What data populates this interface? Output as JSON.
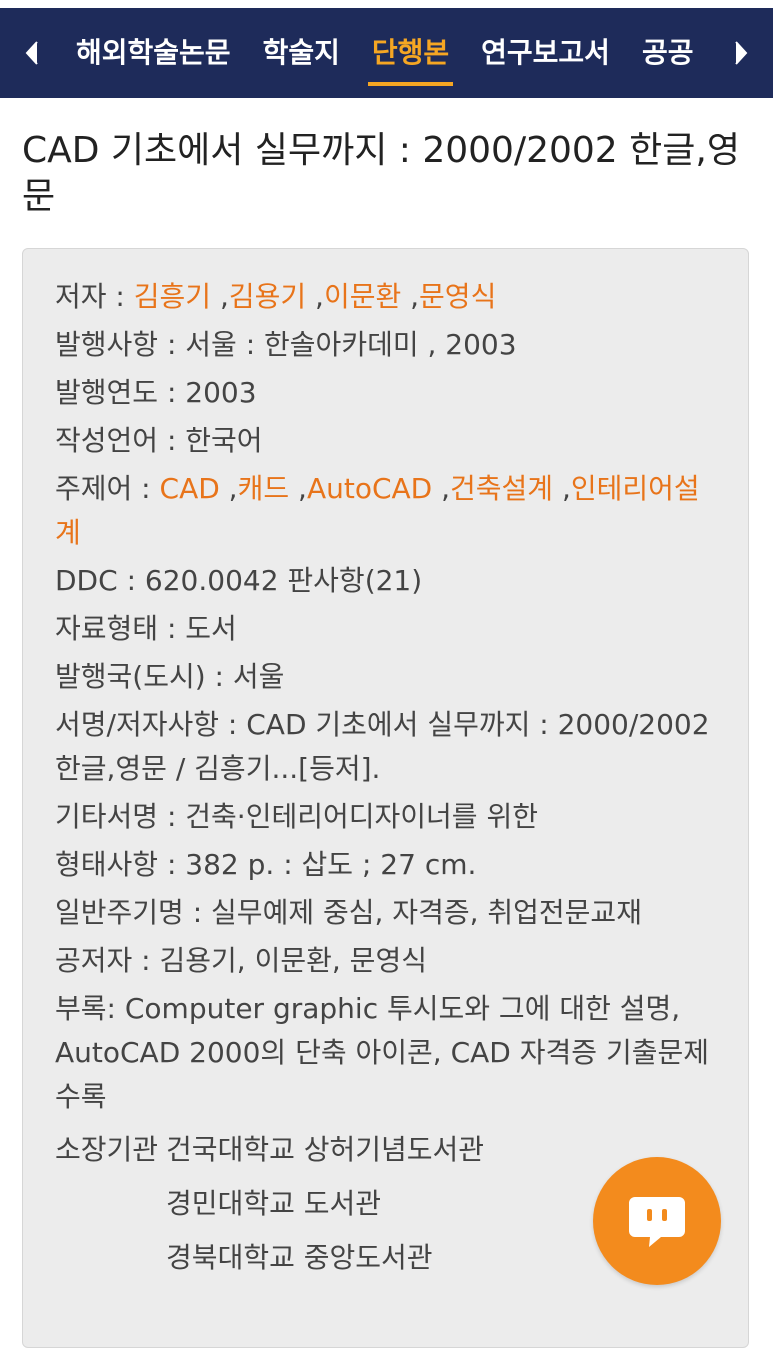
{
  "tabs": {
    "items": [
      {
        "label": "해외학술논문"
      },
      {
        "label": "학술지"
      },
      {
        "label": "단행본"
      },
      {
        "label": "연구보고서"
      },
      {
        "label": "공공"
      }
    ],
    "active": "단행본",
    "prev_icon": "chevron-left-icon",
    "next_icon": "chevron-right-icon"
  },
  "title": "CAD 기초에서 실무까지 : 2000/2002 한글,영문",
  "details": {
    "author_label": "저자 : ",
    "authors": [
      "김흥기",
      "김용기",
      "이문환",
      "문영식"
    ],
    "publication_label": "발행사항 : ",
    "publication": "서울 : 한솔아카데미 , 2003",
    "year_label": "발행연도 : ",
    "year": "2003",
    "language_label": "작성언어 : ",
    "language": "한국어",
    "subjects_label": "주제어 : ",
    "subjects": [
      "CAD",
      "캐드",
      "AutoCAD",
      "건축설계",
      "인테리어설계"
    ],
    "ddc_label": "DDC : ",
    "ddc": "620.0042 판사항(21)",
    "format_label": "자료형태 : ",
    "format": "도서",
    "country_label": "발행국(도시) : ",
    "country": "서울",
    "statement_label": "서명/저자사항 : ",
    "statement": "CAD 기초에서 실무까지 : 2000/2002 한글,영문 / 김흥기...[등저].",
    "other_title_label": "기타서명 : ",
    "other_title": "건축·인테리어디자이너를 위한",
    "physical_label": "형태사항 : ",
    "physical": "382 p. : 삽도 ; 27 cm.",
    "note_label": "일반주기명 : ",
    "note": "실무예제 중심, 자격증, 취업전문교재",
    "coauthors_label": "공저자 : ",
    "coauthors": "김용기, 이문환, 문영식",
    "appendix_label": "부록: ",
    "appendix": "Computer graphic 투시도와 그에 대한 설명, AutoCAD 2000의 단축 아이콘, CAD 자격증 기출문제 수록",
    "holdings_label": "소장기관",
    "holdings": [
      "건국대학교 상허기념도서관",
      "경민대학교 도서관",
      "경북대학교 중앙도서관"
    ]
  },
  "chat_button": {
    "icon": "chat-bubble-icon",
    "color": "#f38b1d"
  },
  "colors": {
    "header_bg": "#1e2b5a",
    "active_tab": "#f5a623",
    "link": "#e8741a",
    "card_bg": "#ececec"
  }
}
